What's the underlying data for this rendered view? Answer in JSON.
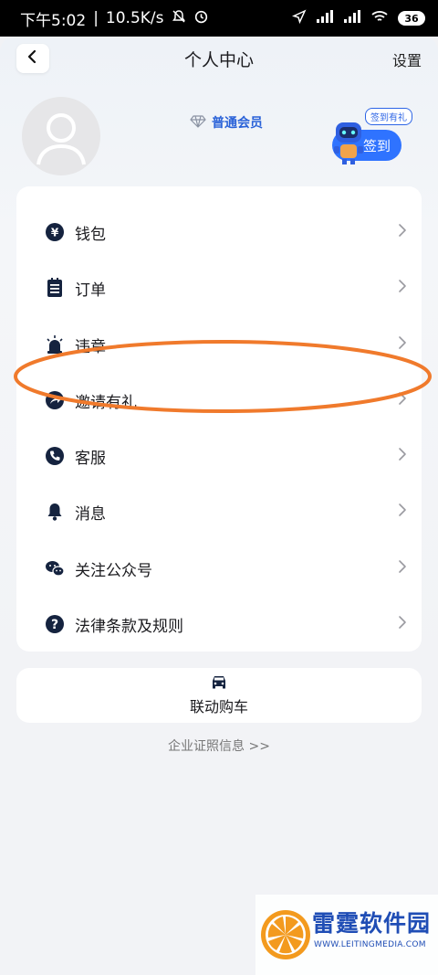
{
  "status_bar": {
    "time": "下午5:02",
    "speed": "10.5K/s",
    "battery": "36"
  },
  "nav": {
    "title": "个人中心",
    "settings_label": "设置"
  },
  "profile": {
    "member_label": "普通会员",
    "checkin_bubble": "签到有礼",
    "checkin_label": "签到"
  },
  "menu": [
    {
      "label": "钱包",
      "icon": "wallet-icon"
    },
    {
      "label": "订单",
      "icon": "order-icon"
    },
    {
      "label": "违章",
      "icon": "alarm-light-icon"
    },
    {
      "label": "邀请有礼",
      "icon": "share-arrow-icon"
    },
    {
      "label": "客服",
      "icon": "phone-icon"
    },
    {
      "label": "消息",
      "icon": "bell-icon"
    },
    {
      "label": "关注公众号",
      "icon": "wechat-icon"
    },
    {
      "label": "法律条款及规则",
      "icon": "question-icon"
    }
  ],
  "car_section": {
    "label": "联动购车",
    "icon": "car-icon"
  },
  "license_link": "企业证照信息  >>",
  "watermark": {
    "title": "雷霆软件园",
    "url": "WWW.LEITINGMEDIA.COM"
  },
  "colors": {
    "accent": "#2f73ff",
    "highlight": "#f07a2c",
    "icon": "#15233f"
  }
}
